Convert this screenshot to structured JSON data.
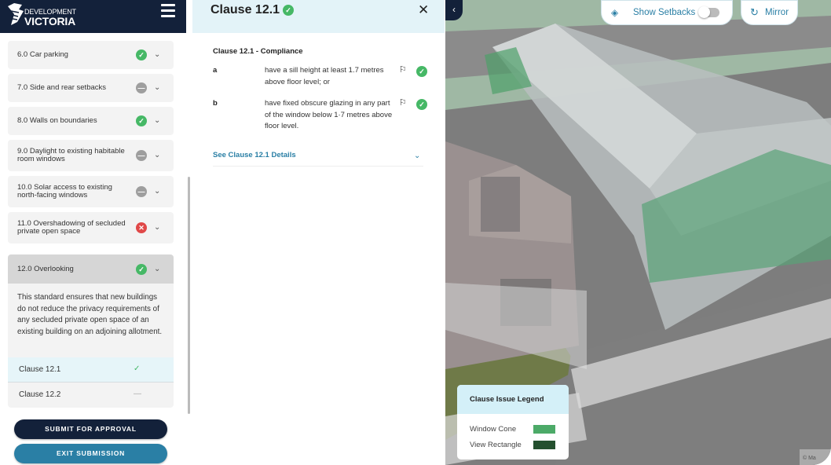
{
  "header": {
    "brand_top": "DEVELOPMENT",
    "brand_bottom": "VICTORIA"
  },
  "sidebar": {
    "items": [
      {
        "label": "6.0 Car parking",
        "status": "pass"
      },
      {
        "label": "7.0 Side and rear setbacks",
        "status": "na"
      },
      {
        "label": "8.0 Walls on boundaries",
        "status": "pass"
      },
      {
        "label": "9.0 Daylight to existing habitable room windows",
        "status": "na"
      },
      {
        "label": "10.0 Solar access to existing north-facing windows",
        "status": "na"
      },
      {
        "label": "11.0 Overshadowing of secluded private open space",
        "status": "fail"
      },
      {
        "label": "12.0 Overlooking",
        "status": "pass"
      }
    ],
    "open_item": {
      "description": "This standard ensures that new buildings do not reduce the privacy requirements of any secluded private open space of an existing building on an adjoining allotment.",
      "clauses": [
        {
          "label": "Clause 12.1",
          "mark": "✓"
        },
        {
          "label": "Clause 12.2",
          "mark": "—"
        }
      ]
    },
    "submit_label": "SUBMIT FOR APPROVAL",
    "exit_label": "EXIT SUBMISSION"
  },
  "panel": {
    "title": "Clause 12.1",
    "compliance_heading": "Clause 12.1 - Compliance",
    "criteria": [
      {
        "key": "a",
        "text": "have a sill height at least 1.7 metres above floor level; or",
        "status": "pass"
      },
      {
        "key": "b",
        "text": "have fixed obscure glazing in any part of the window below 1·7 metres above floor level.",
        "status": "pass"
      }
    ],
    "details_link": "See Clause 12.1 Details"
  },
  "map": {
    "show_setbacks_label": "Show Setbacks",
    "show_setbacks_on": false,
    "mirror_label": "Mirror",
    "legend": {
      "title": "Clause Issue Legend",
      "items": [
        {
          "label": "Window Cone",
          "color": "#4caa68"
        },
        {
          "label": "View Rectangle",
          "color": "#24502f"
        }
      ]
    },
    "attribution": "© Ma"
  },
  "colors": {
    "navy": "#13213a",
    "teal": "#2a7fa5",
    "pass": "#46b866",
    "fail": "#e04848",
    "na": "#9e9e9e"
  }
}
